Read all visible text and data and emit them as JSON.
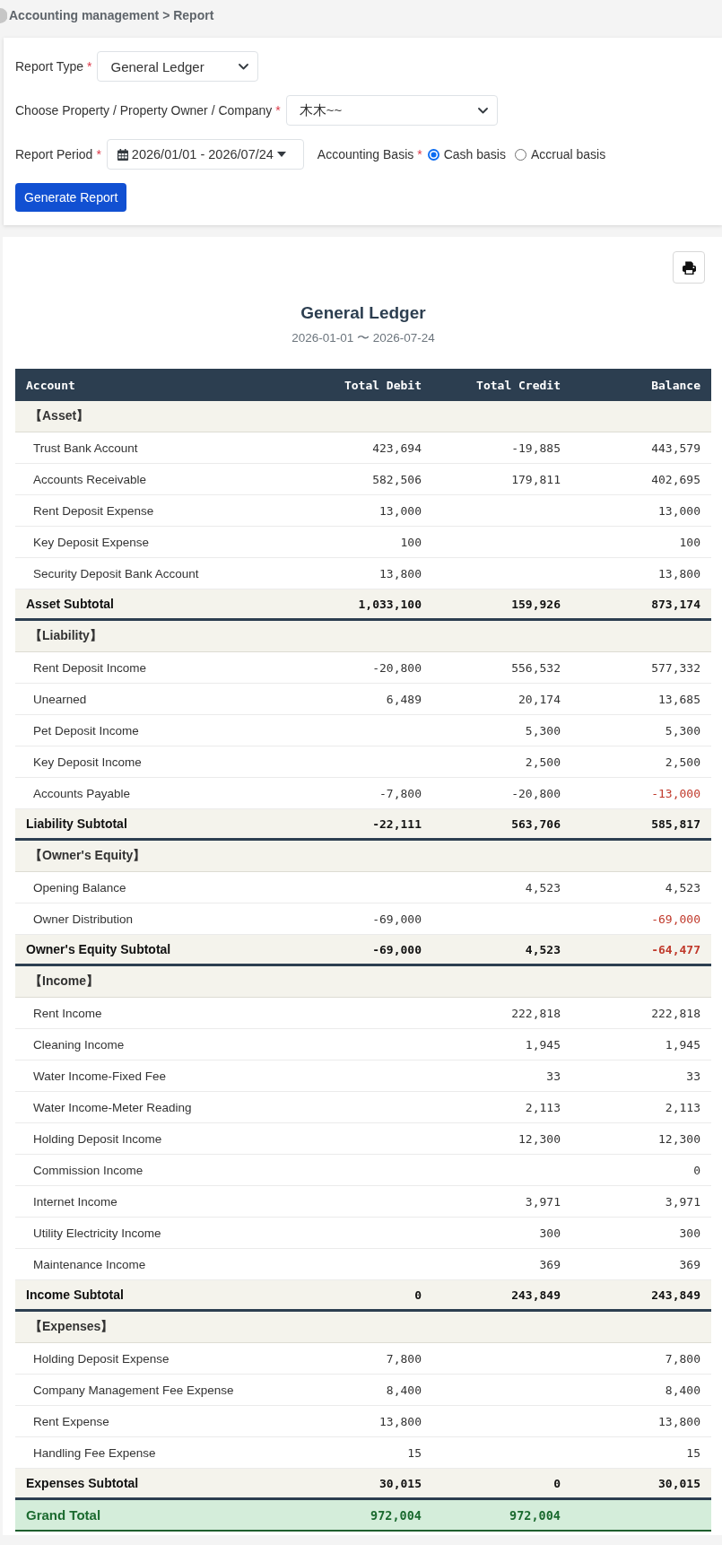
{
  "breadcrumb": "Accounting management > Report",
  "form": {
    "report_type": {
      "label": "Report Type",
      "required_mark": "*",
      "value": "General Ledger"
    },
    "property": {
      "label": "Choose Property / Property Owner / Company",
      "required_mark": "*",
      "value": "木木~~"
    },
    "report_period": {
      "label": "Report Period",
      "required_mark": "*",
      "value": "2026/01/01 - 2026/07/24"
    },
    "accounting_basis": {
      "label": "Accounting Basis",
      "required_mark": "*",
      "options": [
        {
          "label": "Cash basis",
          "selected": true
        },
        {
          "label": "Accrual basis",
          "selected": false
        }
      ]
    },
    "submit": "Generate Report"
  },
  "report": {
    "title": "General Ledger",
    "period": "2026-01-01 〜 2026-07-24",
    "columns": [
      "Account",
      "Total Debit",
      "Total Credit",
      "Balance"
    ],
    "sections": [
      {
        "title": "【Asset】",
        "rows": [
          {
            "account": "Trust Bank Account",
            "debit": "423,694",
            "credit": "-19,885",
            "balance": "443,579",
            "balance_negative": false
          },
          {
            "account": "Accounts Receivable",
            "debit": "582,506",
            "credit": "179,811",
            "balance": "402,695",
            "balance_negative": false
          },
          {
            "account": "Rent Deposit Expense",
            "debit": "13,000",
            "balance": "13,000",
            "balance_negative": false
          },
          {
            "account": "Key Deposit Expense",
            "debit": "100",
            "balance": "100",
            "balance_negative": false
          },
          {
            "account": "Security Deposit Bank Account",
            "debit": "13,800",
            "balance": "13,800",
            "balance_negative": false
          }
        ],
        "subtotal": {
          "label": "Asset Subtotal",
          "debit": "1,033,100",
          "credit": "159,926",
          "balance": "873,174",
          "balance_negative": false
        }
      },
      {
        "title": "【Liability】",
        "rows": [
          {
            "account": "Rent Deposit Income",
            "debit": "-20,800",
            "credit": "556,532",
            "balance": "577,332",
            "balance_negative": false
          },
          {
            "account": "Unearned",
            "debit": "6,489",
            "credit": "20,174",
            "balance": "13,685",
            "balance_negative": false
          },
          {
            "account": "Pet Deposit Income",
            "credit": "5,300",
            "balance": "5,300",
            "balance_negative": false
          },
          {
            "account": "Key Deposit Income",
            "credit": "2,500",
            "balance": "2,500",
            "balance_negative": false
          },
          {
            "account": "Accounts Payable",
            "debit": "-7,800",
            "credit": "-20,800",
            "balance": "-13,000",
            "balance_negative": true
          }
        ],
        "subtotal": {
          "label": "Liability Subtotal",
          "debit": "-22,111",
          "credit": "563,706",
          "balance": "585,817",
          "balance_negative": false
        }
      },
      {
        "title": "【Owner's Equity】",
        "rows": [
          {
            "account": "Opening Balance",
            "credit": "4,523",
            "balance": "4,523",
            "balance_negative": false
          },
          {
            "account": "Owner Distribution",
            "debit": "-69,000",
            "balance": "-69,000",
            "balance_negative": true
          }
        ],
        "subtotal": {
          "label": "Owner's Equity Subtotal",
          "debit": "-69,000",
          "credit": "4,523",
          "balance": "-64,477",
          "balance_negative": true
        }
      },
      {
        "title": "【Income】",
        "rows": [
          {
            "account": "Rent Income",
            "credit": "222,818",
            "balance": "222,818",
            "balance_negative": false
          },
          {
            "account": "Cleaning Income",
            "credit": "1,945",
            "balance": "1,945",
            "balance_negative": false
          },
          {
            "account": "Water Income-Fixed Fee",
            "credit": "33",
            "balance": "33",
            "balance_negative": false
          },
          {
            "account": "Water Income-Meter Reading",
            "credit": "2,113",
            "balance": "2,113",
            "balance_negative": false
          },
          {
            "account": "Holding Deposit Income",
            "credit": "12,300",
            "balance": "12,300",
            "balance_negative": false
          },
          {
            "account": "Commission Income",
            "balance": "0",
            "balance_negative": false
          },
          {
            "account": "Internet Income",
            "credit": "3,971",
            "balance": "3,971",
            "balance_negative": false
          },
          {
            "account": "Utility Electricity Income",
            "credit": "300",
            "balance": "300",
            "balance_negative": false
          },
          {
            "account": "Maintenance Income",
            "credit": "369",
            "balance": "369",
            "balance_negative": false
          }
        ],
        "subtotal": {
          "label": "Income Subtotal",
          "debit": "0",
          "credit": "243,849",
          "balance": "243,849",
          "balance_negative": false
        }
      },
      {
        "title": "【Expenses】",
        "rows": [
          {
            "account": "Holding Deposit Expense",
            "debit": "7,800",
            "balance": "7,800",
            "balance_negative": false
          },
          {
            "account": "Company Management Fee Expense",
            "debit": "8,400",
            "balance": "8,400",
            "balance_negative": false
          },
          {
            "account": "Rent Expense",
            "debit": "13,800",
            "balance": "13,800",
            "balance_negative": false
          },
          {
            "account": "Handling Fee Expense",
            "debit": "15",
            "balance": "15",
            "balance_negative": false
          }
        ],
        "subtotal": {
          "label": "Expenses Subtotal",
          "debit": "30,015",
          "credit": "0",
          "balance": "30,015",
          "balance_negative": false
        }
      }
    ],
    "grand_total": {
      "label": "Grand Total",
      "debit": "972,004",
      "credit": "972,004"
    }
  }
}
